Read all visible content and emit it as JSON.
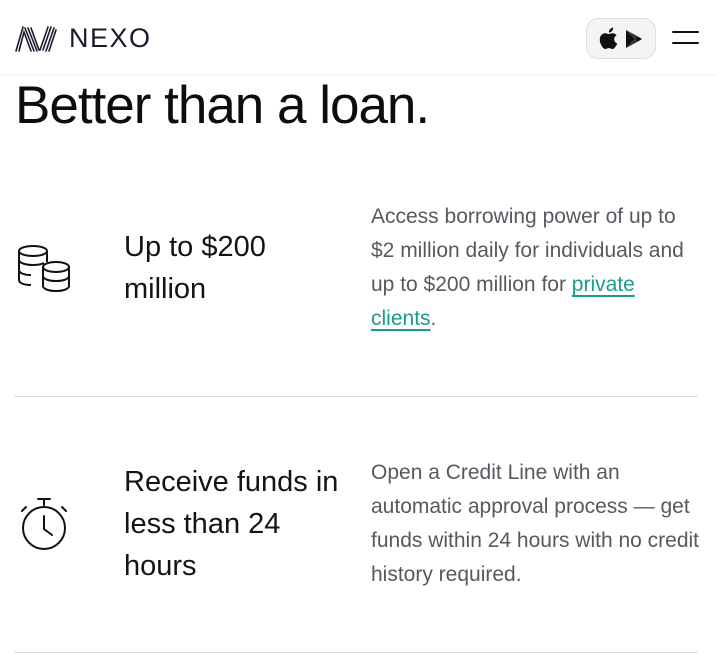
{
  "header": {
    "brand": "NEXO",
    "store_button_icons": [
      "apple-icon",
      "play-store-icon"
    ],
    "menu_icon": "hamburger-icon"
  },
  "hero": {
    "title": "Better than a loan."
  },
  "features": [
    {
      "icon": "coins-stack-icon",
      "title": "Up to $200 million",
      "description_prefix": "Access borrowing power of up to $2 million daily for individuals and up to $200 million for ",
      "link_text": "private clients",
      "description_suffix": "."
    },
    {
      "icon": "stopwatch-icon",
      "title": "Receive funds in less than 24 hours",
      "description": "Open a Credit Line with an automatic approval process — get funds within 24 hours with no credit history required."
    }
  ],
  "colors": {
    "link": "#1a9c8c",
    "text": "#111111",
    "muted": "#555a60",
    "divider": "#dddddd"
  }
}
